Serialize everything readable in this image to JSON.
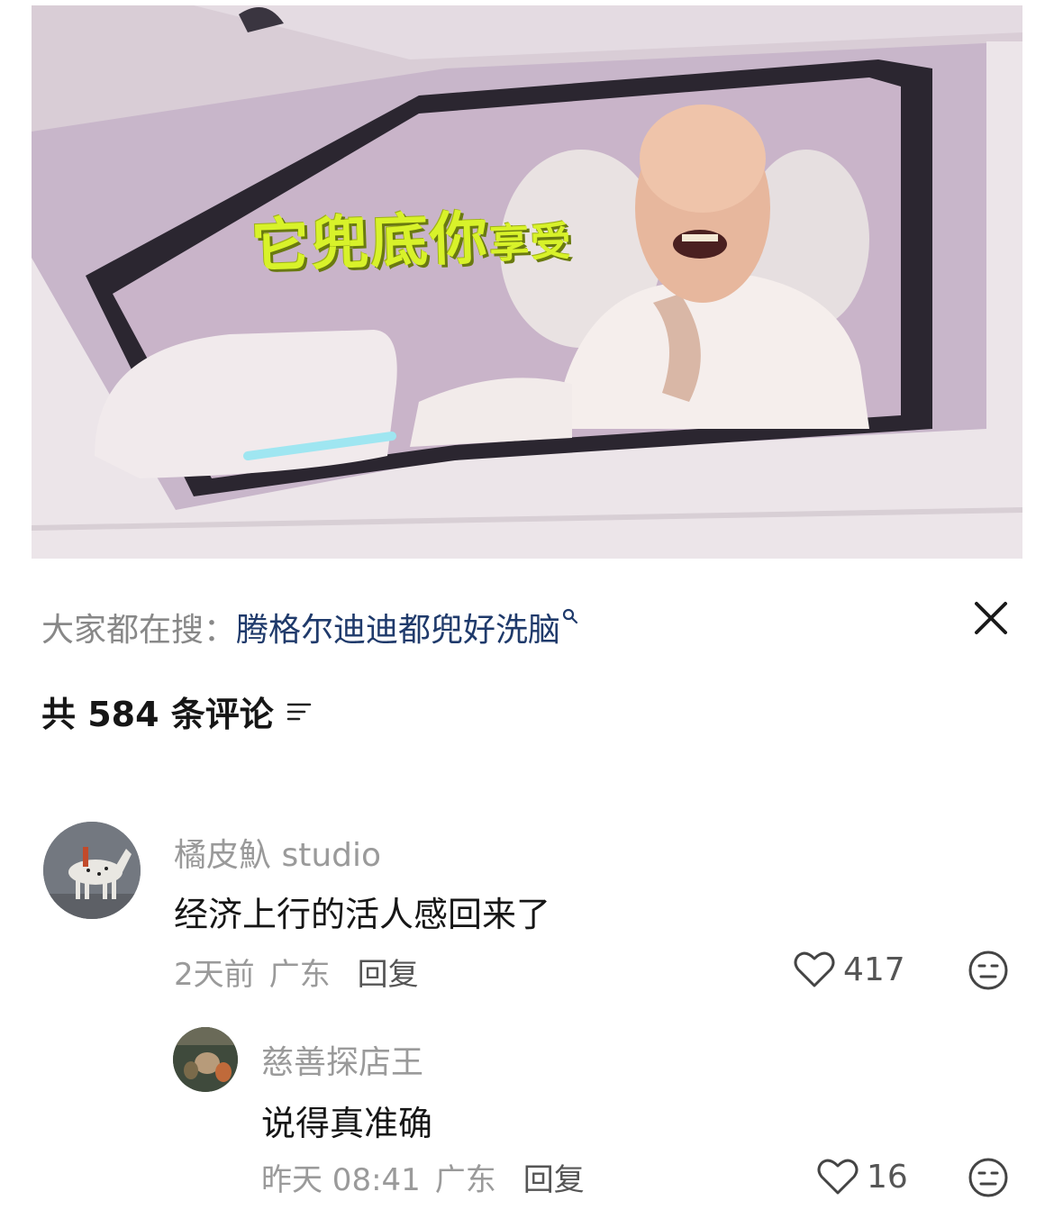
{
  "video": {
    "caption_main": "它兜底你",
    "caption_small": "享受"
  },
  "search": {
    "prefix": "大家都在搜：",
    "term": "腾格尔迪迪都兜好洗脑"
  },
  "comments_header": {
    "label": "共 584 条评论"
  },
  "comments": [
    {
      "username": "橘皮魞 studio",
      "content": "经济上行的活人感回来了",
      "time": "2天前",
      "location": "广东",
      "reply_label": "回复",
      "likes": "417"
    },
    {
      "username": "慈善探店王",
      "content": "说得真准确",
      "time": "昨天 08:41",
      "location": "广东",
      "reply_label": "回复",
      "likes": "16"
    }
  ],
  "colors": {
    "accent_link": "#1f3a6b",
    "caption": "#d8f22a",
    "muted": "#9a9a9a"
  },
  "icons": [
    "search-icon",
    "close-icon",
    "sort-icon",
    "heart-icon",
    "dislike-face-icon"
  ]
}
